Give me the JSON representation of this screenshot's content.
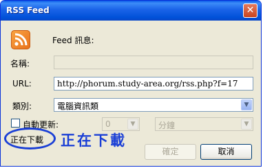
{
  "window": {
    "title": "RSS Feed",
    "close_glyph": "✕"
  },
  "header": {
    "icon": "rss-feed-icon",
    "label": "Feed 訊息:"
  },
  "form": {
    "name_label": "名稱:",
    "name_value": "",
    "url_label": "URL:",
    "url_value": "http://phorum.study-area.org/rss.php?f=17",
    "category_label": "類別:",
    "category_value": "電腦資訊類",
    "auto_update_label": "自動更新:",
    "auto_update_checked": false,
    "interval_value": "0",
    "unit_value": "分鐘"
  },
  "status": {
    "text": "正在下載",
    "annotation": "正在下載"
  },
  "buttons": {
    "ok_label": "確定",
    "cancel_label": "取消"
  },
  "colors": {
    "annotation": "#1a3fd6",
    "titlebar": "#0a5ae8"
  }
}
